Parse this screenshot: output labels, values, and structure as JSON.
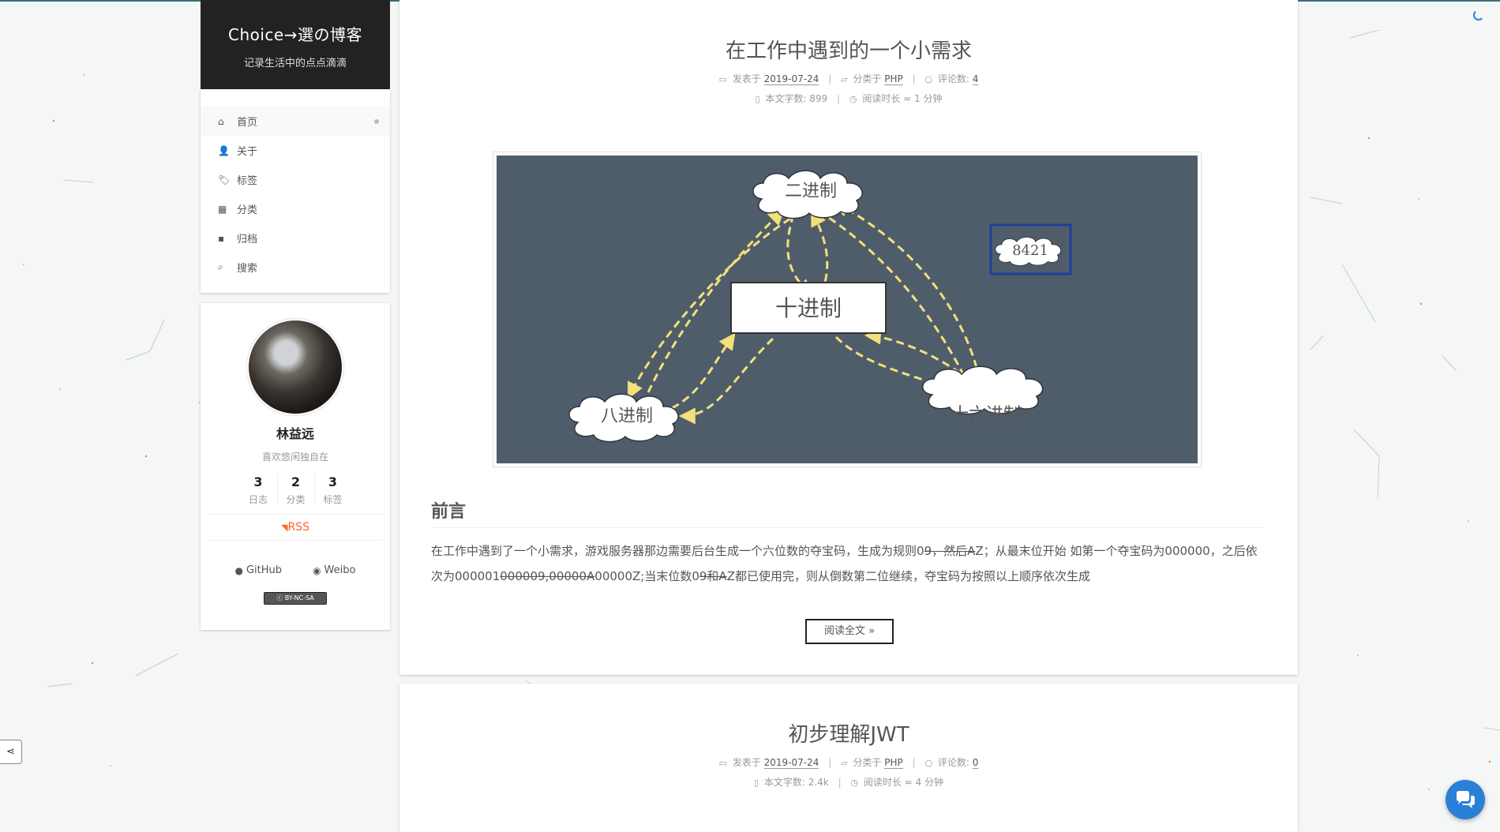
{
  "site": {
    "title": "Choice→選の博客",
    "subtitle": "记录生活中的点点滴滴"
  },
  "menu": [
    {
      "label": "首页",
      "icon": "home-icon",
      "glyph": "⌂",
      "active": true
    },
    {
      "label": "关于",
      "icon": "user-icon",
      "glyph": "👤",
      "active": false
    },
    {
      "label": "标签",
      "icon": "tags-icon",
      "glyph": "🏷",
      "active": false
    },
    {
      "label": "分类",
      "icon": "th-icon",
      "glyph": "▦",
      "active": false
    },
    {
      "label": "归档",
      "icon": "archive-icon",
      "glyph": "▪",
      "active": false
    },
    {
      "label": "搜索",
      "icon": "search-icon",
      "glyph": "⌕",
      "active": false
    }
  ],
  "profile": {
    "name": "林益远",
    "description": "喜欢悠闲独自在",
    "stats": [
      {
        "count": "3",
        "label": "日志"
      },
      {
        "count": "2",
        "label": "分类"
      },
      {
        "count": "3",
        "label": "标签"
      }
    ],
    "rss": "RSS",
    "links": [
      {
        "label": "GitHub",
        "icon": "github-icon"
      },
      {
        "label": "Weibo",
        "icon": "weibo-icon"
      }
    ],
    "license": "BY-NC-SA"
  },
  "posts": [
    {
      "title": "在工作中遇到的一个小需求",
      "meta": {
        "posted_label": "发表于",
        "date": "2019-07-24",
        "category_label": "分类于",
        "category": "PHP",
        "comments_label": "评论数:",
        "comments": "4",
        "wordcount_label": "本文字数:",
        "wordcount": "899",
        "readtime_label": "阅读时长 ≈",
        "readtime": "1 分钟"
      },
      "figure": {
        "nodes": {
          "binary": "二进制",
          "decimal": "十进制",
          "octal": "八进制",
          "hex": "十六进制",
          "bcd": "8421"
        },
        "colors": {
          "background": "#4f5d6b",
          "arrow": "#f2e07a",
          "highlight": "#1f3f9a"
        }
      },
      "section_heading": "前言",
      "paragraph": {
        "part1": "在工作中遇到了一个小需求，游戏服务器那边需要后台生成一个六位数的夺宝码，生成为规则0",
        "struck1": "9，然后A",
        "part2": "Z；从最末位开始 如第一个夺宝码为000000，之后依次为000001",
        "struck2": "000009,00000A",
        "part3": "00000Z;当末位数0",
        "struck3": "9和A",
        "part4": "Z都已使用完，则从倒数第二位继续，夺宝码为按照以上顺序依次生成"
      },
      "read_more": "阅读全文 »"
    },
    {
      "title": "初步理解JWT",
      "meta": {
        "posted_label": "发表于",
        "date": "2019-07-24",
        "category_label": "分类于",
        "category": "PHP",
        "comments_label": "评论数:",
        "comments": "0",
        "wordcount_label": "本文字数:",
        "wordcount": "2.4k",
        "readtime_label": "阅读时长 ≈",
        "readtime": "4 分钟"
      }
    }
  ],
  "widgets": {
    "share_icon": "share-icon",
    "chat_icon": "chat-bubbles-icon"
  }
}
